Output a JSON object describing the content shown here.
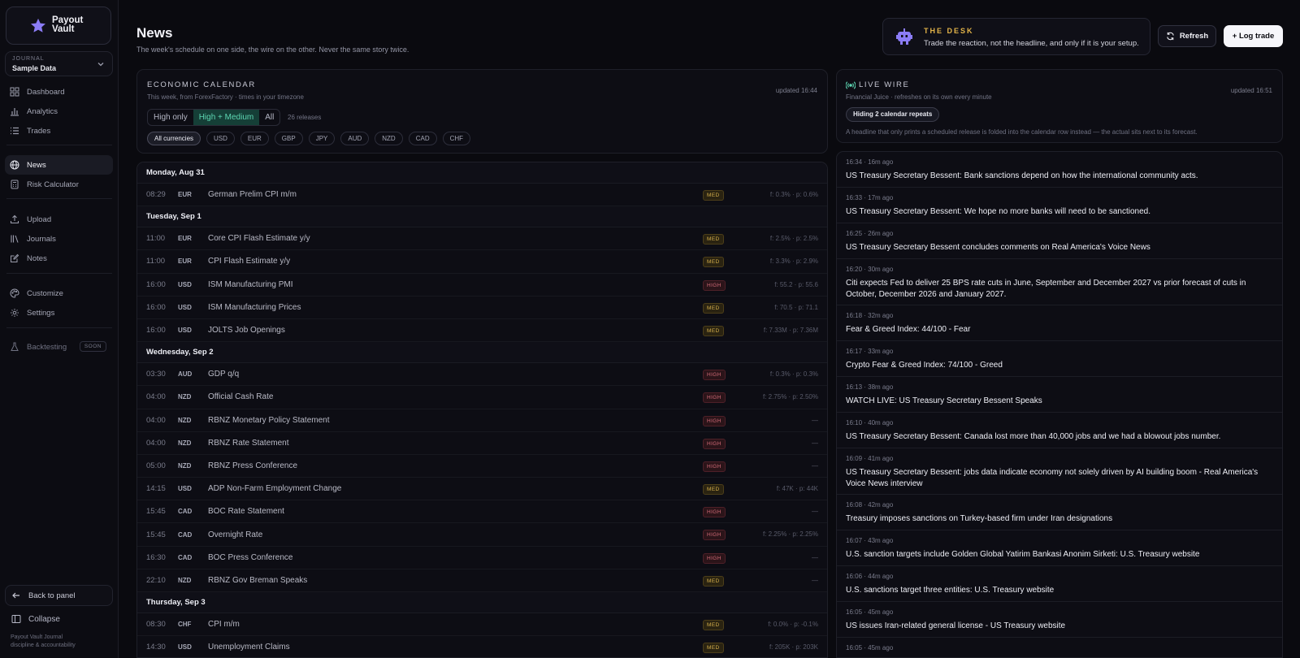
{
  "brand": {
    "name_line1": "Payout",
    "name_line2": "Vault"
  },
  "journal": {
    "kicker": "JOURNAL",
    "value": "Sample Data"
  },
  "nav": {
    "dashboard": "Dashboard",
    "analytics": "Analytics",
    "trades": "Trades",
    "news": "News",
    "risk": "Risk Calculator",
    "upload": "Upload",
    "journals": "Journals",
    "notes": "Notes",
    "customize": "Customize",
    "settings": "Settings",
    "backtesting": "Backtesting",
    "soon": "SOON"
  },
  "sidebar_footer": {
    "back": "Back to panel",
    "collapse": "Collapse",
    "line1": "Payout Vault Journal",
    "line2": "discipline & accountability"
  },
  "header": {
    "title": "News",
    "subtitle": "The week's schedule on one side, the wire on the other. Never the same story twice.",
    "desk_kicker": "THE DESK",
    "desk_text": "Trade the reaction, not the headline, and only if it is your setup.",
    "refresh": "Refresh",
    "log_trade": "+ Log trade"
  },
  "calendar": {
    "kicker": "ECONOMIC CALENDAR",
    "sub": "This week, from ForexFactory · times in your timezone",
    "updated": "updated 16:44",
    "filters": [
      "High only",
      "High + Medium",
      "All"
    ],
    "releases": "26 releases",
    "currencies": [
      "All currencies",
      "USD",
      "EUR",
      "GBP",
      "JPY",
      "AUD",
      "NZD",
      "CAD",
      "CHF"
    ],
    "days": [
      {
        "label": "Monday, Aug 31",
        "events": [
          {
            "time": "08:29",
            "cur": "EUR",
            "name": "German Prelim CPI m/m",
            "impact": "MED",
            "fc": "f: 0.3% · p: 0.6%"
          }
        ]
      },
      {
        "label": "Tuesday, Sep 1",
        "events": [
          {
            "time": "11:00",
            "cur": "EUR",
            "name": "Core CPI Flash Estimate y/y",
            "impact": "MED",
            "fc": "f: 2.5% · p: 2.5%"
          },
          {
            "time": "11:00",
            "cur": "EUR",
            "name": "CPI Flash Estimate y/y",
            "impact": "MED",
            "fc": "f: 3.3% · p: 2.9%"
          },
          {
            "time": "16:00",
            "cur": "USD",
            "name": "ISM Manufacturing PMI",
            "impact": "HIGH",
            "fc": "f: 55.2 · p: 55.6"
          },
          {
            "time": "16:00",
            "cur": "USD",
            "name": "ISM Manufacturing Prices",
            "impact": "MED",
            "fc": "f: 70.5 · p: 71.1"
          },
          {
            "time": "16:00",
            "cur": "USD",
            "name": "JOLTS Job Openings",
            "impact": "MED",
            "fc": "f: 7.33M · p: 7.36M"
          }
        ]
      },
      {
        "label": "Wednesday, Sep 2",
        "events": [
          {
            "time": "03:30",
            "cur": "AUD",
            "name": "GDP q/q",
            "impact": "HIGH",
            "fc": "f: 0.3% · p: 0.3%"
          },
          {
            "time": "04:00",
            "cur": "NZD",
            "name": "Official Cash Rate",
            "impact": "HIGH",
            "fc": "f: 2.75% · p: 2.50%"
          },
          {
            "time": "04:00",
            "cur": "NZD",
            "name": "RBNZ Monetary Policy Statement",
            "impact": "HIGH",
            "fc": "—"
          },
          {
            "time": "04:00",
            "cur": "NZD",
            "name": "RBNZ Rate Statement",
            "impact": "HIGH",
            "fc": "—"
          },
          {
            "time": "05:00",
            "cur": "NZD",
            "name": "RBNZ Press Conference",
            "impact": "HIGH",
            "fc": "—"
          },
          {
            "time": "14:15",
            "cur": "USD",
            "name": "ADP Non-Farm Employment Change",
            "impact": "MED",
            "fc": "f: 47K · p: 44K"
          },
          {
            "time": "15:45",
            "cur": "CAD",
            "name": "BOC Rate Statement",
            "impact": "HIGH",
            "fc": "—"
          },
          {
            "time": "15:45",
            "cur": "CAD",
            "name": "Overnight Rate",
            "impact": "HIGH",
            "fc": "f: 2.25% · p: 2.25%"
          },
          {
            "time": "16:30",
            "cur": "CAD",
            "name": "BOC Press Conference",
            "impact": "HIGH",
            "fc": "—"
          },
          {
            "time": "22:10",
            "cur": "NZD",
            "name": "RBNZ Gov Breman Speaks",
            "impact": "MED",
            "fc": "—"
          }
        ]
      },
      {
        "label": "Thursday, Sep 3",
        "events": [
          {
            "time": "08:30",
            "cur": "CHF",
            "name": "CPI m/m",
            "impact": "MED",
            "fc": "f: 0.0% · p: -0.1%"
          },
          {
            "time": "14:30",
            "cur": "USD",
            "name": "Unemployment Claims",
            "impact": "MED",
            "fc": "f: 205K · p: 203K"
          }
        ]
      }
    ]
  },
  "wire": {
    "kicker": "LIVE WIRE",
    "sub": "Financial Juice · refreshes on its own every minute",
    "updated": "updated 16:51",
    "hiding": "Hiding 2 calendar repeats",
    "note": "A headline that only prints a scheduled release is folded into the calendar row instead — the actual sits next to its forecast.",
    "items": [
      {
        "ts": "16:34 · 16m ago",
        "text": "US Treasury Secretary Bessent: Bank sanctions depend on how the international community acts."
      },
      {
        "ts": "16:33 · 17m ago",
        "text": "US Treasury Secretary Bessent: We hope no more banks will need to be sanctioned."
      },
      {
        "ts": "16:25 · 26m ago",
        "text": "US Treasury Secretary Bessent concludes comments on Real America's Voice News"
      },
      {
        "ts": "16:20 · 30m ago",
        "text": "Citi expects Fed to deliver 25 BPS rate cuts in June, September and December 2027 vs prior forecast of cuts in October, December 2026 and January 2027."
      },
      {
        "ts": "16:18 · 32m ago",
        "text": "Fear & Greed Index: 44/100 - Fear"
      },
      {
        "ts": "16:17 · 33m ago",
        "text": "Crypto Fear & Greed Index: 74/100 - Greed"
      },
      {
        "ts": "16:13 · 38m ago",
        "text": "WATCH LIVE: US Treasury Secretary Bessent Speaks"
      },
      {
        "ts": "16:10 · 40m ago",
        "text": "US Treasury Secretary Bessent: Canada lost more than 40,000 jobs and we had a blowout jobs number."
      },
      {
        "ts": "16:09 · 41m ago",
        "text": "US Treasury Secretary Bessent: jobs data indicate economy not solely driven by AI building boom - Real America's Voice News interview"
      },
      {
        "ts": "16:08 · 42m ago",
        "text": "Treasury imposes sanctions on Turkey-based firm under Iran designations"
      },
      {
        "ts": "16:07 · 43m ago",
        "text": "U.S. sanction targets include Golden Global Yatirim Bankasi Anonim Sirketi: U.S. Treasury website"
      },
      {
        "ts": "16:06 · 44m ago",
        "text": "U.S. sanctions target three entities: U.S. Treasury website"
      },
      {
        "ts": "16:05 · 45m ago",
        "text": "US issues Iran-related general license - US Treasury website"
      },
      {
        "ts": "16:05 · 45m ago",
        "text": ""
      }
    ]
  },
  "colors": {
    "accent_teal": "#5dd7b3",
    "med": "#d3ad4b",
    "high": "#d36b78",
    "desk_gold": "#e3b449",
    "brand_purple": "#8b7cf6"
  }
}
